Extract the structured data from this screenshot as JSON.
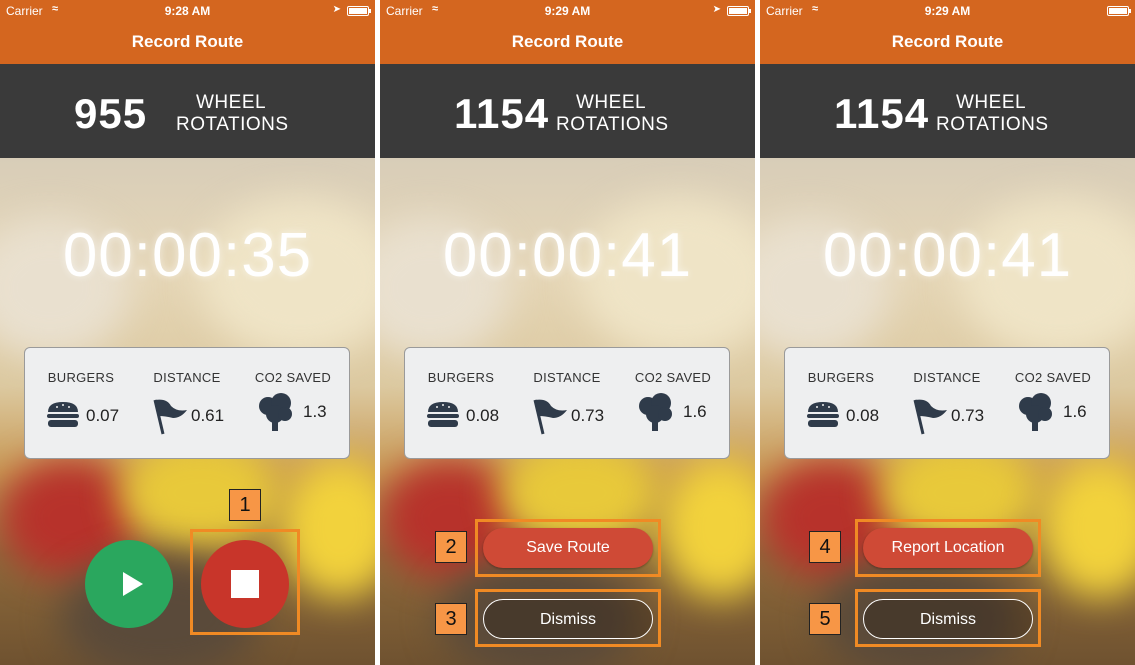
{
  "app": {
    "status": {
      "carrier": "Carrier"
    },
    "nav_title": "Record Route",
    "wheel_label": [
      "WHEEL",
      "ROTATIONS"
    ],
    "stat_headers": [
      "BURGERS",
      "DISTANCE",
      "CO2 SAVED"
    ]
  },
  "screens": [
    {
      "time": "9:28 AM",
      "rotations": "955",
      "timer": "00:00:35",
      "burgers": "0.07",
      "distance": "0.61",
      "co2": "1.3",
      "show_location_arrow": true
    },
    {
      "time": "9:29 AM",
      "rotations": "1154",
      "timer": "00:00:41",
      "burgers": "0.08",
      "distance": "0.73",
      "co2": "1.6",
      "primary_button": "Save Route",
      "secondary_button": "Dismiss",
      "show_location_arrow": true
    },
    {
      "time": "9:29 AM",
      "rotations": "1154",
      "timer": "00:00:41",
      "burgers": "0.08",
      "distance": "0.73",
      "co2": "1.6",
      "primary_button": "Report Location",
      "secondary_button": "Dismiss",
      "show_location_arrow": false
    }
  ],
  "callouts": [
    "1",
    "2",
    "3",
    "4",
    "5"
  ],
  "colors": {
    "nav": "#d4661f",
    "wheel_bar": "#3a3a3a",
    "play": "#2aa75e",
    "stop": "#c8352a",
    "primary_button": "#cf4a36",
    "highlight": "#f08a24"
  },
  "icons": [
    "wifi-icon",
    "location-arrow-icon",
    "battery-icon",
    "burger-icon",
    "flag-icon",
    "tree-icon",
    "play-icon",
    "stop-icon"
  ]
}
